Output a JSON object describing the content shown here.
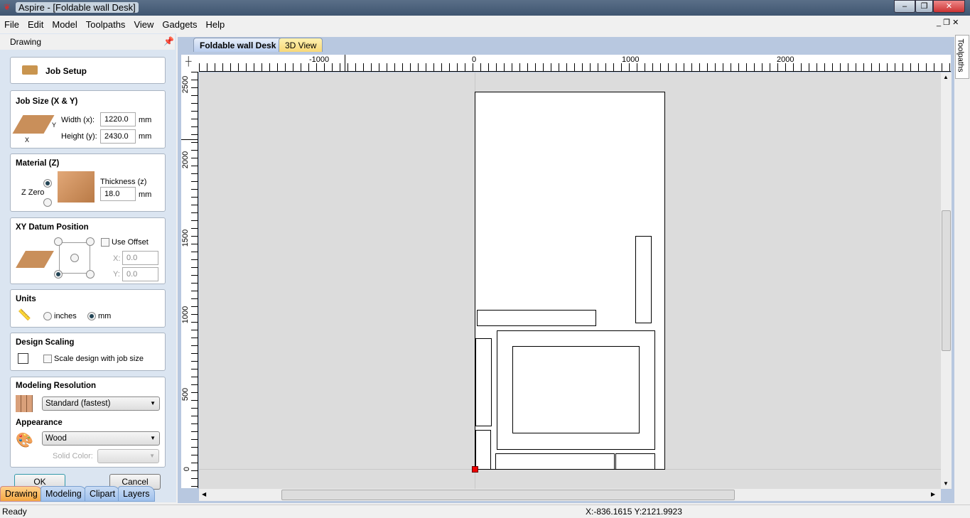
{
  "window": {
    "title": "Aspire - [Foldable wall Desk]"
  },
  "menu": [
    "File",
    "Edit",
    "Model",
    "Toolpaths",
    "View",
    "Gadgets",
    "Help"
  ],
  "panel": {
    "title": "Drawing",
    "job_setup": "Job Setup",
    "job_size": {
      "heading": "Job Size (X & Y)",
      "width_label": "Width (x):",
      "width": "1220.0",
      "height_label": "Height (y):",
      "height": "2430.0",
      "unit": "mm",
      "x": "X",
      "y": "Y"
    },
    "material": {
      "heading": "Material (Z)",
      "z_zero": "Z Zero",
      "thickness_label": "Thickness (z)",
      "thickness": "18.0",
      "unit": "mm"
    },
    "datum": {
      "heading": "XY Datum Position",
      "use_offset": "Use Offset",
      "x_label": "X:",
      "x": "0.0",
      "y_label": "Y:",
      "y": "0.0"
    },
    "units": {
      "heading": "Units",
      "inches": "inches",
      "mm": "mm"
    },
    "scaling": {
      "heading": "Design Scaling",
      "scale_label": "Scale design with job size"
    },
    "resolution": {
      "heading": "Modeling Resolution",
      "value": "Standard (fastest)"
    },
    "appearance": {
      "heading": "Appearance",
      "value": "Wood",
      "solid_color": "Solid Color:"
    },
    "ok": "OK",
    "cancel": "Cancel"
  },
  "bottom_tabs": [
    "Drawing",
    "Modeling",
    "Clipart",
    "Layers"
  ],
  "view_tabs": [
    "Foldable wall Desk",
    "3D View"
  ],
  "ruler": {
    "x": [
      "-1000",
      "0",
      "1000",
      "2000"
    ],
    "y": [
      "2500",
      "2000",
      "1500",
      "1000",
      "500",
      "0"
    ]
  },
  "right_tab": "Toolpaths",
  "status": {
    "text": "Ready",
    "coords": "X:-836.1615 Y:2121.9923"
  }
}
